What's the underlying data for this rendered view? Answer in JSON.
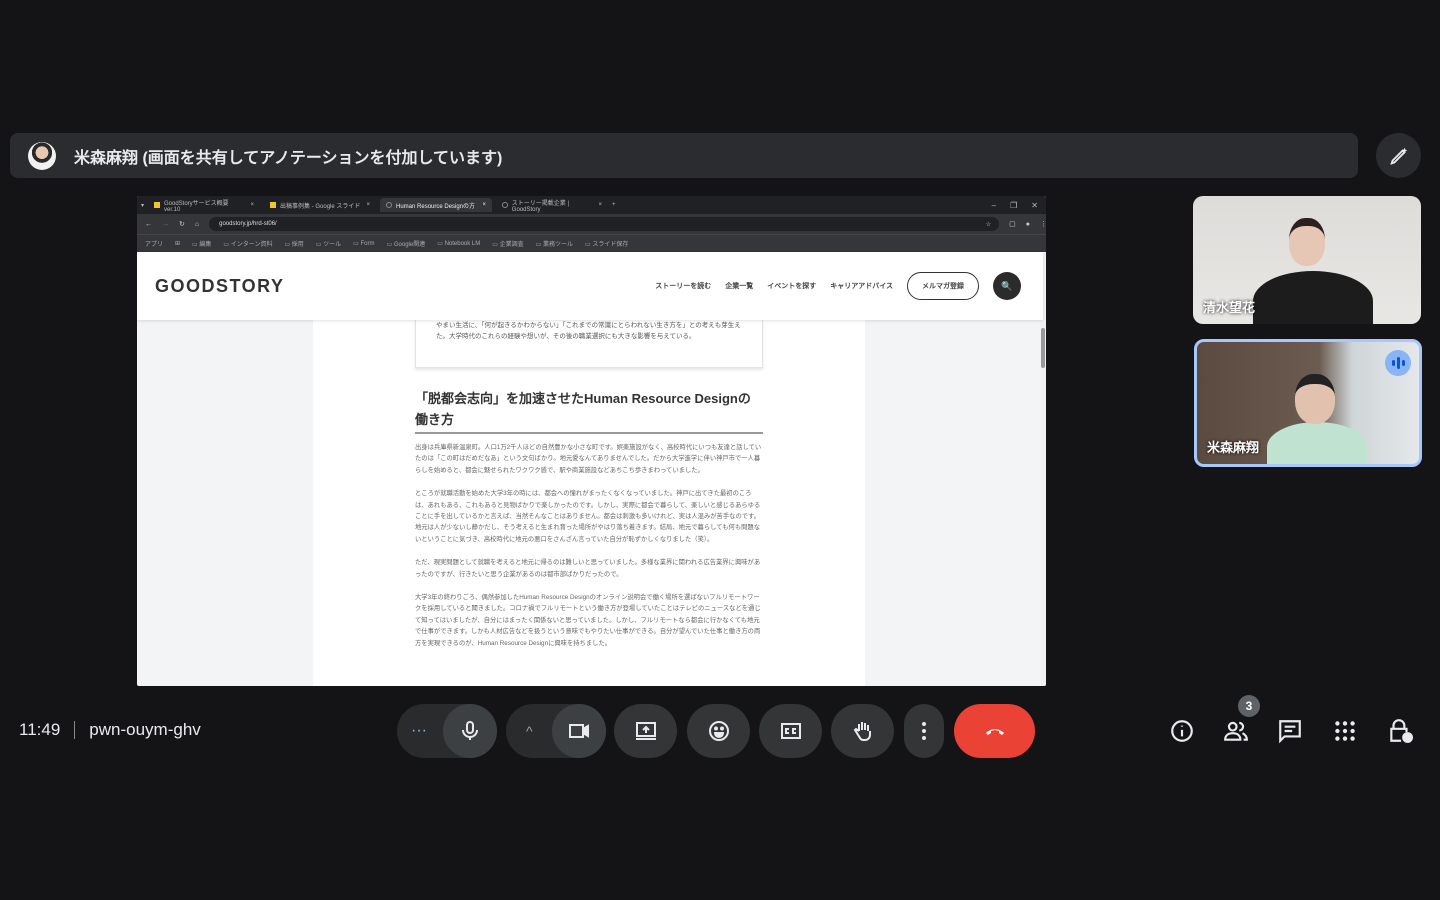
{
  "banner": {
    "text": "米森麻翔 (画面を共有してアノテーションを付加しています)"
  },
  "browser": {
    "tabs": [
      {
        "label": "GoodStoryサービス概要 ver.10"
      },
      {
        "label": "出稿事例集 - Google スライド"
      },
      {
        "label": "Human Resource Designの方"
      },
      {
        "label": "ストーリー掲載企業 | GoodStory"
      }
    ],
    "new_tab": "+",
    "url": "goodstory.jp/hrd-st06/",
    "bookmarks": [
      "アプリ",
      "⊞",
      "編集",
      "インターン資料",
      "採用",
      "ツール",
      "Form",
      "Google関連",
      "Notebook LM",
      "企業調査",
      "業務ツール",
      "スライド保存"
    ]
  },
  "site": {
    "logo": "GOODSTORY",
    "nav": [
      "ストーリーを読む",
      "企業一覧",
      "イベントを探す",
      "キャリアアドバイス"
    ],
    "newsletter": "メルマガ登録",
    "search_icon": "🔍"
  },
  "article": {
    "card_text": "やまい生活に、「何が起きるかわからない」「これまでの常識にとらわれない生き方を」との考えも芽生えた。大学時代のこれらの経験や想いが、その後の職業選択にも大きな影響を与えている。",
    "heading": "「脱都会志向」を加速させたHuman Resource Designの働き方",
    "paragraphs": [
      "出身は兵庫県新温泉町。人口1万2千人ほどの自然豊かな小さな町です。娯楽施設がなく、高校時代にいつも友達と話していたのは「この町はだめだなあ」という文句ばかり。地元愛なんてありませんでした。だから大学進学に伴い神戸市で一人暮らしを始めると、都会に魅せられたワクワク感で、駅や商業施設などあちこち歩きまわっていました。",
      "ところが就職活動を始めた大学3年の時には、都会への憧れがまったくなくなっていました。神戸に出てきた最初のころは、あれもある、これもあると見物ばかりで楽しかったのです。しかし、実際に都会で暮らして、楽しいと感じるあらゆることに手を出しているかと言えば、当然そんなことはありません。都会は刺激も多いけれど、実は人混みが苦手なのです。地元は人が少ないし静かだし、そう考えると生まれ育った場所がやはり落ち着きます。結局、地元で暮らしても何も問題ないということに気づき、高校時代に地元の悪口をさんざん言っていた自分が恥ずかしくなりました（笑）。",
      "ただ、現実問題として就職を考えると地元に帰るのは難しいと思っていました。多様な業界に関われる広告業界に興味があったのですが、行きたいと思う企業があるのは都市部ばかりだったので。",
      "大学3年の終わりごろ、偶然参加したHuman Resource Designのオンライン説明会で働く場所を選ばないフルリモートワークを採用していると聞きました。コロナ禍でフルリモートという働き方が登場していたことはテレビのニュースなどを通じて知ってはいましたが、自分にはまったく関係ないと思っていました。しかし、フルリモートなら都会に行かなくても地元で仕事ができます。しかも人材広告などを扱うという意味でもやりたい仕事ができる。自分が望んでいた仕事と働き方の両方を実現できるのが、Human Resource Designに興味を持ちました。"
    ]
  },
  "participants": [
    {
      "name": "清水望花"
    },
    {
      "name": "米森麻翔",
      "speaking": true
    }
  ],
  "meeting": {
    "time": "11:49",
    "code": "pwn-ouym-ghv",
    "participant_count": "3"
  },
  "colors": {
    "end_call": "#ea4335",
    "speaking_border": "#a8c7fa",
    "background": "#141416"
  }
}
